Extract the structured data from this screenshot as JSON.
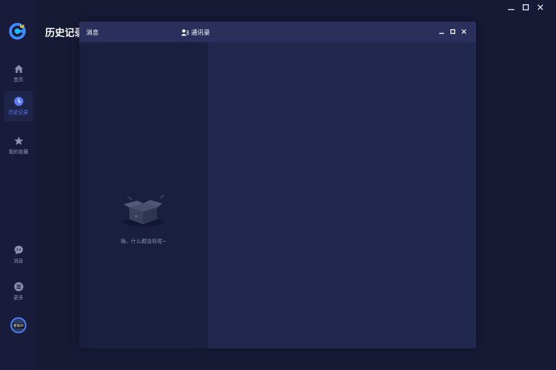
{
  "app": {
    "page_title": "历史记录",
    "window_controls": [
      "minimize",
      "maximize",
      "close"
    ]
  },
  "sidebar": {
    "items": [
      {
        "label": "首页",
        "icon": "home-icon",
        "active": false
      },
      {
        "label": "历史记录",
        "icon": "clock-icon",
        "active": true
      },
      {
        "label": "我的收藏",
        "icon": "star-icon",
        "active": false
      },
      {
        "label": "消息",
        "icon": "chat-icon",
        "active": false
      },
      {
        "label": "更多",
        "icon": "more-icon",
        "active": false
      }
    ],
    "avatar_text": "老铁中"
  },
  "dialog": {
    "title": "消息",
    "contacts_tab": "通讯录",
    "empty_message": "嗨，什么都没有呢~"
  },
  "colors": {
    "accent": "#5b7bff",
    "background": "#161a35",
    "sidebar": "#181c3a",
    "dialog_header": "#2a2f5c",
    "dialog_left": "#1a1f3d",
    "dialog_right": "#22274d"
  }
}
